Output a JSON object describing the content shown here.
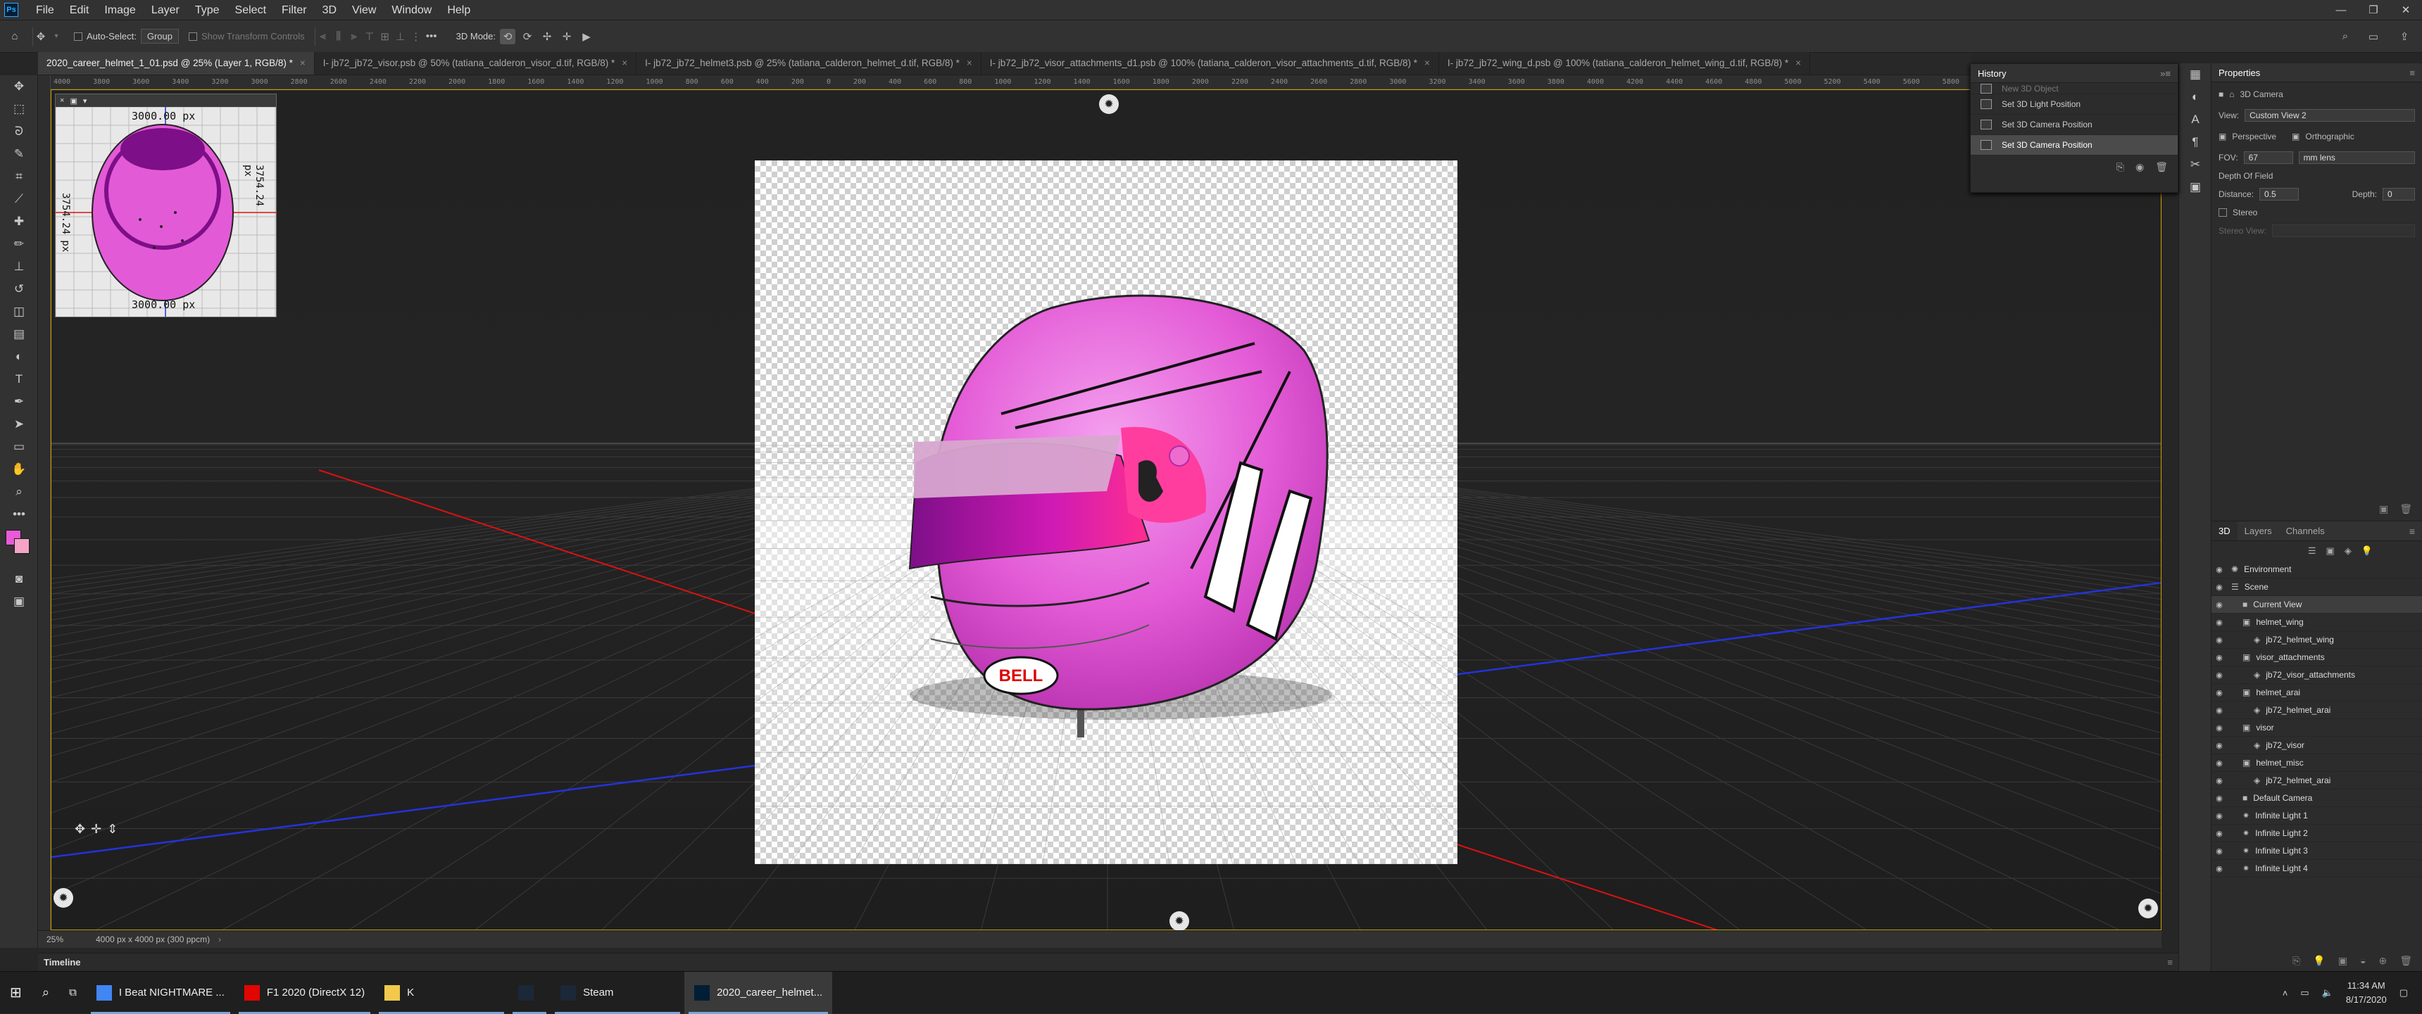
{
  "app": {
    "name": "Ps",
    "accent": "#31a8ff"
  },
  "menubar": {
    "items": [
      "File",
      "Edit",
      "Image",
      "Layer",
      "Type",
      "Select",
      "Filter",
      "3D",
      "View",
      "Window",
      "Help"
    ],
    "window_controls": {
      "minimize": "—",
      "restore": "❐",
      "close": "✕"
    }
  },
  "options": {
    "auto_select_label": "Auto-Select:",
    "auto_select_value": "Group",
    "show_transform_label": "Show Transform Controls",
    "mode_3d_label": "3D Mode:"
  },
  "tabs": [
    {
      "label": "2020_career_helmet_1_01.psd @ 25% (Layer 1, RGB/8) *",
      "active": true
    },
    {
      "label": "I- jb72_jb72_visor.psb @ 50% (tatiana_calderon_visor_d.tif, RGB/8) *",
      "active": false
    },
    {
      "label": "I- jb72_jb72_helmet3.psb @ 25% (tatiana_calderon_helmet_d.tif, RGB/8) *",
      "active": false
    },
    {
      "label": "I- jb72_jb72_visor_attachments_d1.psb @ 100% (tatiana_calderon_visor_attachments_d.tif, RGB/8) *",
      "active": false
    },
    {
      "label": "I- jb72_jb72_wing_d.psb @ 100% (tatiana_calderon_helmet_wing_d.tif, RGB/8) *",
      "active": false
    }
  ],
  "ruler": {
    "top_text": "4000 3800 3600 3400 3200 3000 2800 2600 2400 2200 2000 1800 1600 1400 1200 1000 800 600 400 200 0 200 400 600 800 1000 1200 1400 1600 1800 2000 2200 2400 2600 2800 3000 3200 3400 3600 3800 4000 4200 4400 4600 4800 5000 5200 5400 5600 5800 6000 6200 6400 6600"
  },
  "minicam": {
    "top": "3000.00 px",
    "bottom": "3000.00 px",
    "left": "3754.24 px",
    "right": "3754.24 px"
  },
  "status": {
    "zoom": "25%",
    "doc_size": "4000 px x 4000 px (300 ppcm)"
  },
  "timeline": {
    "label": "Timeline"
  },
  "history": {
    "title": "History",
    "items": [
      {
        "label": "New 3D Object",
        "selected": false
      },
      {
        "label": "Set 3D Light Position",
        "selected": false
      },
      {
        "label": "Set 3D Camera Position",
        "selected": false
      },
      {
        "label": "Set 3D Camera Position",
        "selected": true
      }
    ]
  },
  "properties": {
    "title": "Properties",
    "kind": "3D Camera",
    "view_label": "View:",
    "view_value": "Custom View 2",
    "perspective": "Perspective",
    "orthographic": "Orthographic",
    "fov_label": "FOV:",
    "fov_value": "67",
    "lens": "mm lens",
    "dof_label": "Depth Of Field",
    "distance_label": "Distance:",
    "distance_value": "0.5",
    "depth_label": "Depth:",
    "depth_value": "0",
    "stereo_label": "Stereo",
    "stereo_view_label": "Stereo View:"
  },
  "scene_panel": {
    "tabs": [
      "3D",
      "Layers",
      "Channels"
    ],
    "rows": [
      {
        "label": "Environment",
        "indent": 0,
        "selected": false,
        "icon": "environment-icon"
      },
      {
        "label": "Scene",
        "indent": 0,
        "selected": false,
        "icon": "scene-icon"
      },
      {
        "label": "Current View",
        "indent": 1,
        "selected": true,
        "icon": "camera-icon"
      },
      {
        "label": "helmet_wing",
        "indent": 1,
        "selected": false,
        "icon": "mesh-icon"
      },
      {
        "label": "jb72_helmet_wing",
        "indent": 2,
        "selected": false,
        "icon": "material-icon"
      },
      {
        "label": "visor_attachments",
        "indent": 1,
        "selected": false,
        "icon": "mesh-icon"
      },
      {
        "label": "jb72_visor_attachments",
        "indent": 2,
        "selected": false,
        "icon": "material-icon"
      },
      {
        "label": "helmet_arai",
        "indent": 1,
        "selected": false,
        "icon": "mesh-icon"
      },
      {
        "label": "jb72_helmet_arai",
        "indent": 2,
        "selected": false,
        "icon": "material-icon"
      },
      {
        "label": "visor",
        "indent": 1,
        "selected": false,
        "icon": "mesh-icon"
      },
      {
        "label": "jb72_visor",
        "indent": 2,
        "selected": false,
        "icon": "material-icon"
      },
      {
        "label": "helmet_misc",
        "indent": 1,
        "selected": false,
        "icon": "mesh-icon"
      },
      {
        "label": "jb72_helmet_arai",
        "indent": 2,
        "selected": false,
        "icon": "material-icon"
      },
      {
        "label": "Default Camera",
        "indent": 1,
        "selected": false,
        "icon": "camera-icon"
      },
      {
        "label": "Infinite Light 1",
        "indent": 1,
        "selected": false,
        "icon": "light-icon"
      },
      {
        "label": "Infinite Light 2",
        "indent": 1,
        "selected": false,
        "icon": "light-icon"
      },
      {
        "label": "Infinite Light 3",
        "indent": 1,
        "selected": false,
        "icon": "light-icon"
      },
      {
        "label": "Infinite Light 4",
        "indent": 1,
        "selected": false,
        "icon": "light-icon"
      }
    ]
  },
  "helmet": {
    "brand": "BELL",
    "color": "#e85ad8"
  },
  "taskbar": {
    "items": [
      {
        "label": "I Beat NIGHTMARE ...",
        "icon": "chrome-icon",
        "color": "#4285f4",
        "open": true,
        "active": false
      },
      {
        "label": "F1 2020 (DirectX 12)",
        "icon": "f1-icon",
        "color": "#e10600",
        "open": true,
        "active": false
      },
      {
        "label": "K",
        "icon": "folder-icon",
        "color": "#f2c94c",
        "open": true,
        "active": false
      },
      {
        "label": "",
        "icon": "steam-icon",
        "color": "#1b2838",
        "open": true,
        "active": false
      },
      {
        "label": "Steam",
        "icon": "steam-icon",
        "color": "#1b2838",
        "open": true,
        "active": false
      },
      {
        "label": "2020_career_helmet...",
        "icon": "photoshop-icon",
        "color": "#001e36",
        "open": true,
        "active": true
      }
    ],
    "time": "11:34 AM",
    "date": "8/17/2020"
  }
}
